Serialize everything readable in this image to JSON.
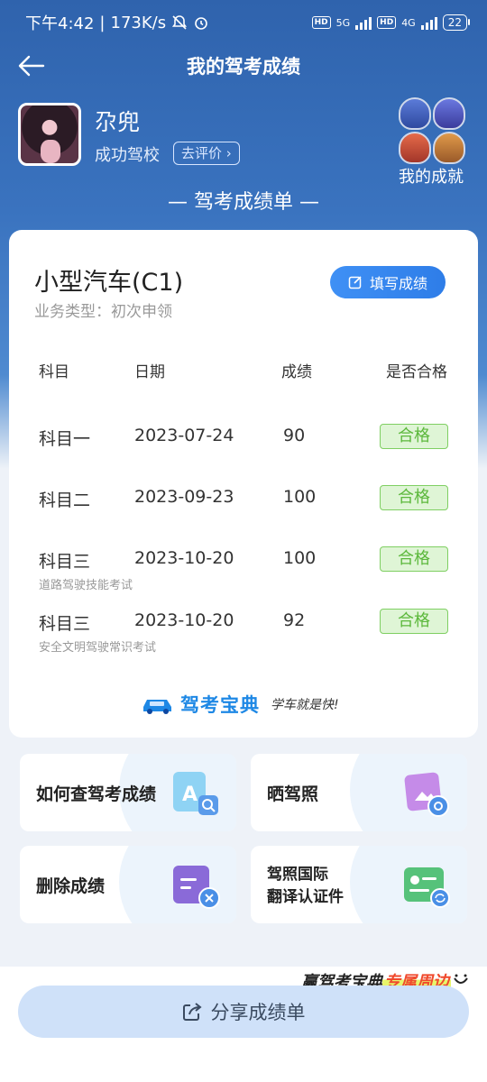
{
  "status_bar": {
    "time": "下午4:42",
    "net_speed": "173K/s",
    "net5g": "5G",
    "net4g": "4G",
    "hd": "HD",
    "battery": "22"
  },
  "nav": {
    "title": "我的驾考成绩"
  },
  "profile": {
    "username": "尕兜",
    "school": "成功驾校",
    "rate_label": "去评价",
    "achievement_label": "我的成就"
  },
  "report": {
    "title": "— 驾考成绩单 —"
  },
  "card": {
    "car_type": "小型汽车(C1)",
    "business_type": "业务类型：初次申领",
    "fill_button": "填写成绩",
    "headers": [
      "科目",
      "日期",
      "成绩",
      "是否合格"
    ],
    "rows": [
      {
        "subject": "科目一",
        "date": "2023-07-24",
        "score": "90",
        "result": "合格",
        "note": ""
      },
      {
        "subject": "科目二",
        "date": "2023-09-23",
        "score": "100",
        "result": "合格",
        "note": ""
      },
      {
        "subject": "科目三",
        "date": "2023-10-20",
        "score": "100",
        "result": "合格",
        "note": "道路驾驶技能考试"
      },
      {
        "subject": "科目三",
        "date": "2023-10-20",
        "score": "92",
        "result": "合格",
        "note": "安全文明驾驶常识考试"
      }
    ],
    "brand_name": "驾考宝典",
    "brand_slogan": "学车就是快!"
  },
  "tiles": {
    "check_scores": "如何查驾考成绩",
    "show_license": "晒驾照",
    "delete_scores": "删除成绩",
    "intl_license_line1": "驾照国际",
    "intl_license_line2": "翻译认证件"
  },
  "promo": {
    "part1": "赢驾考宝典",
    "part2": "专属周边"
  },
  "share_button": "分享成绩单",
  "colors": {
    "header_blue": "#2f63ad",
    "accent_blue": "#2e7de8",
    "pass_green": "#5cb83c",
    "promo_red": "#f04a2d"
  }
}
